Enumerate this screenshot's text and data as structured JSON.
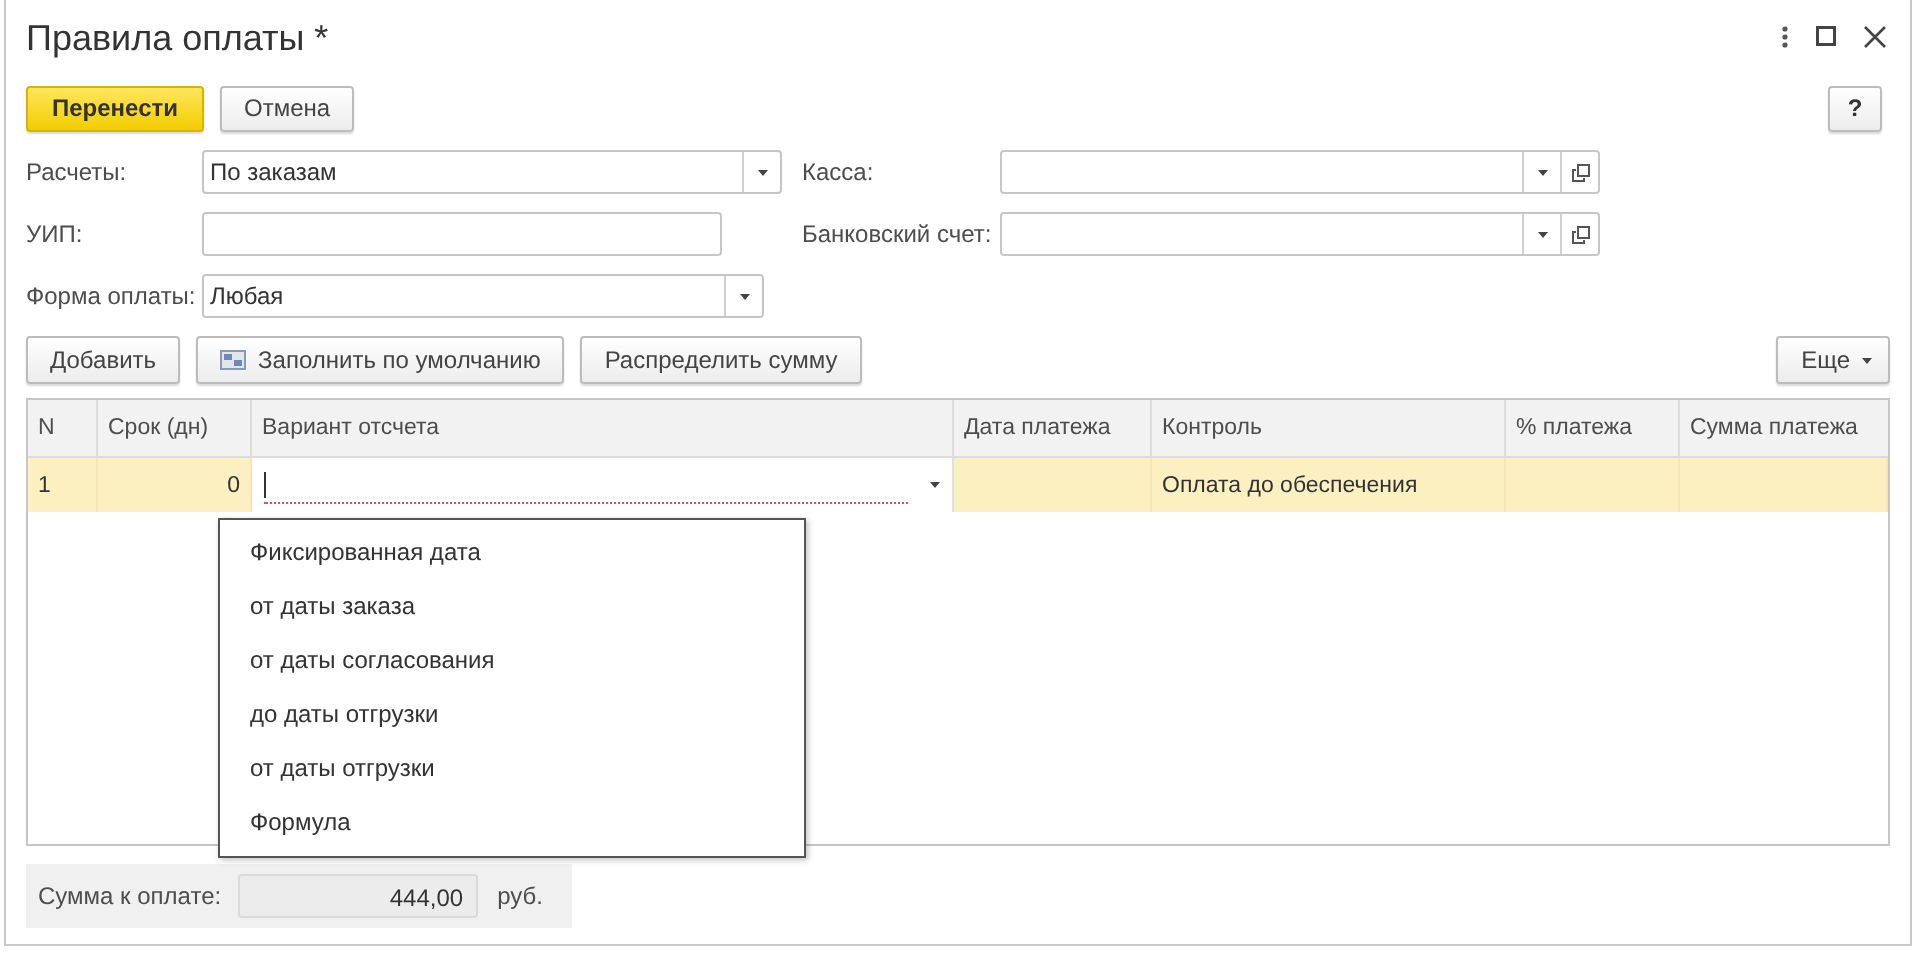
{
  "window": {
    "title": "Правила оплаты *"
  },
  "command_bar": {
    "buttons": [
      {
        "label": "Перенести",
        "kind": "primary"
      },
      {
        "label": "Отмена",
        "kind": "default"
      }
    ],
    "help": "?"
  },
  "form": {
    "rows": [
      [
        {
          "label": "Расчеты:",
          "value": "По заказам",
          "kind": "select"
        },
        {
          "label": "Касса:",
          "kind": "select-open"
        }
      ],
      [
        {
          "label": "УИП:",
          "kind": "text"
        },
        {
          "label": "Банковский счет:",
          "kind": "select-open"
        }
      ],
      [
        {
          "label": "Форма оплаты:",
          "value": "Любая",
          "kind": "select"
        }
      ]
    ]
  },
  "toolbar": {
    "buttons": [
      {
        "label": "Добавить",
        "kind": "plain"
      },
      {
        "label": "Заполнить по умолчанию",
        "kind": "icon"
      },
      {
        "label": "Распределить сумму",
        "kind": "plain"
      }
    ],
    "more": "Еще"
  },
  "table": {
    "columns": [
      {
        "label": "N",
        "kind": "text"
      },
      {
        "label": "Срок (дн)",
        "kind": "number"
      },
      {
        "label": "Вариант отсчета",
        "kind": "choice"
      },
      {
        "label": "Дата платежа",
        "kind": "text"
      },
      {
        "label": "Контроль",
        "kind": "text"
      },
      {
        "label": "% платежа",
        "kind": "number"
      },
      {
        "label": "Сумма платежа",
        "kind": "number"
      }
    ],
    "rows": [
      {
        "selected": true,
        "cells": [
          "1",
          "0",
          null,
          null,
          "Оплата до обеспечения",
          null,
          null
        ]
      }
    ],
    "open_list": {
      "items": [
        "Фиксированная дата",
        "от даты заказа",
        "от даты согласования",
        "до даты отгрузки",
        "от даты отгрузки",
        "Формула"
      ]
    }
  },
  "total": {
    "label": "Сумма к оплате:",
    "value": "444,00",
    "unit": "руб."
  }
}
